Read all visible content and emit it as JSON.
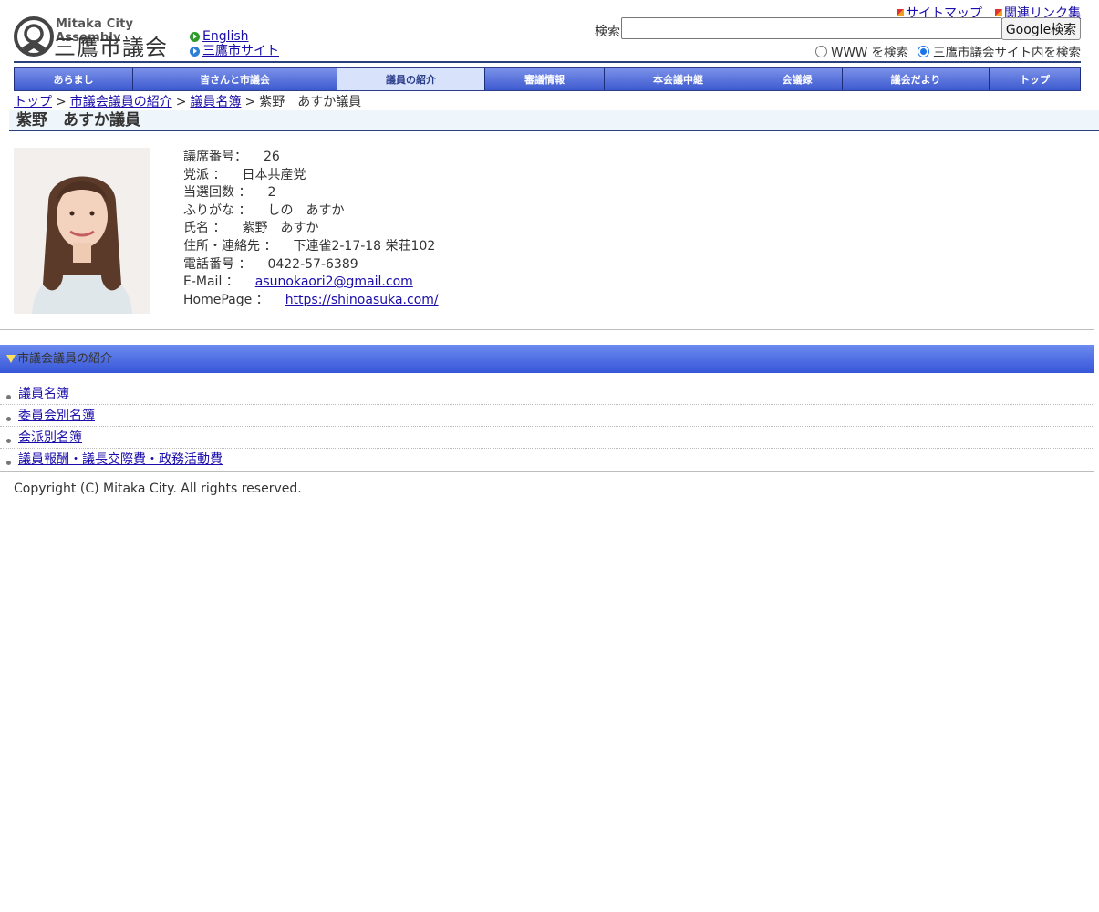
{
  "header": {
    "logo_en": "Mitaka City Assembly",
    "logo_ja": "三鷹市議会",
    "lang_links": [
      "English",
      "三鷹市サイト"
    ],
    "top_links": [
      "サイトマップ",
      "関連リンク集"
    ],
    "search": {
      "label": "検索",
      "value": "",
      "button": "Google検索",
      "radio_options": [
        "WWW を検索",
        "三鷹市議会サイト内を検索"
      ],
      "selected_option": "三鷹市議会サイト内を検索"
    }
  },
  "nav": {
    "items": [
      "あらまし",
      "皆さんと市議会",
      "議員の紹介",
      "審議情報",
      "本会議中継",
      "会議録",
      "議会だより",
      "トップ"
    ],
    "active": "議員の紹介"
  },
  "breadcrumb": [
    "トップ",
    "市議会議員の紹介",
    "議員名簿",
    "紫野　あすか議員"
  ],
  "page_title": "紫野　あすか議員",
  "profile": {
    "fields": [
      {
        "label": "議席番号：",
        "value": "26"
      },
      {
        "label": "党派 ：",
        "value": "日本共産党"
      },
      {
        "label": "当選回数 ：",
        "value": "2"
      },
      {
        "label": "ふりがな ：",
        "value": "しの　あすか"
      },
      {
        "label": "氏名 ：",
        "value": "紫野　あすか"
      },
      {
        "label": "住所・連絡先 ：",
        "value": "下連雀2-17-18 栄荘102"
      },
      {
        "label": "電話番号 ：",
        "value": "0422-57-6389"
      },
      {
        "label": "E-Mail ：",
        "value": "asunokaori2@gmail.com"
      },
      {
        "label": "HomePage ：",
        "value": "https://shinoasuka.com/"
      }
    ]
  },
  "section": {
    "title": "市議会議員の紹介",
    "links": [
      "議員名簿",
      "委員会別名簿",
      "会派別名簿",
      "議員報酬・議長交際費・政務活動費"
    ]
  },
  "footer": "Copyright (C) Mitaka City. All rights reserved.",
  "colors": {
    "nav_gradient_top": "#7a90e8",
    "nav_gradient_bottom": "#3d5ad0",
    "nav_active_bg": "#d8e3fb",
    "rule": "#2a3f7e",
    "link": "#1a0dab"
  }
}
